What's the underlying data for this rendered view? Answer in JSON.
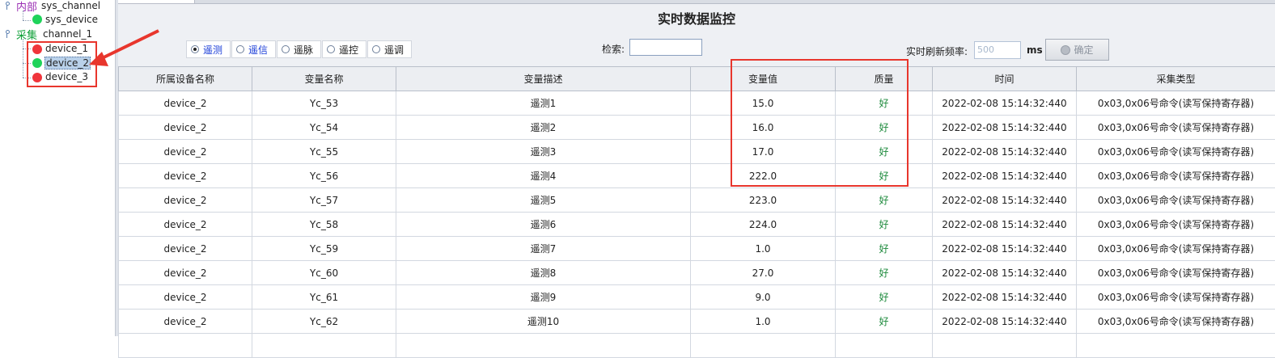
{
  "tree": {
    "internal": {
      "prefix": "内部",
      "name": "sys_channel",
      "device": "sys_device"
    },
    "collect": {
      "prefix": "采集",
      "name": "channel_1",
      "devices": [
        {
          "name": "device_1",
          "status": "red"
        },
        {
          "name": "device_2",
          "status": "green",
          "selected": true
        },
        {
          "name": "device_3",
          "status": "red"
        }
      ]
    }
  },
  "title": "实时数据监控",
  "radios": [
    {
      "label": "遥测",
      "checked": true,
      "blue": true
    },
    {
      "label": "遥信",
      "checked": false,
      "blue": true
    },
    {
      "label": "遥脉",
      "checked": false,
      "blue": false
    },
    {
      "label": "遥控",
      "checked": false,
      "blue": false
    },
    {
      "label": "遥调",
      "checked": false,
      "blue": false
    }
  ],
  "search": {
    "label": "检索:",
    "value": ""
  },
  "refresh": {
    "label": "实时刷新频率:",
    "placeholder": "500",
    "unit": "ms",
    "button": "确定"
  },
  "table": {
    "headers": [
      "所属设备名称",
      "变量名称",
      "变量描述",
      "变量值",
      "质量",
      "时间",
      "采集类型"
    ],
    "rows": [
      [
        "device_2",
        "Yc_53",
        "遥测1",
        "15.0",
        "好",
        "2022-02-08 15:14:32:440",
        "0x03,0x06号命令(读写保持寄存器)"
      ],
      [
        "device_2",
        "Yc_54",
        "遥测2",
        "16.0",
        "好",
        "2022-02-08 15:14:32:440",
        "0x03,0x06号命令(读写保持寄存器)"
      ],
      [
        "device_2",
        "Yc_55",
        "遥测3",
        "17.0",
        "好",
        "2022-02-08 15:14:32:440",
        "0x03,0x06号命令(读写保持寄存器)"
      ],
      [
        "device_2",
        "Yc_56",
        "遥测4",
        "222.0",
        "好",
        "2022-02-08 15:14:32:440",
        "0x03,0x06号命令(读写保持寄存器)"
      ],
      [
        "device_2",
        "Yc_57",
        "遥测5",
        "223.0",
        "好",
        "2022-02-08 15:14:32:440",
        "0x03,0x06号命令(读写保持寄存器)"
      ],
      [
        "device_2",
        "Yc_58",
        "遥测6",
        "224.0",
        "好",
        "2022-02-08 15:14:32:440",
        "0x03,0x06号命令(读写保持寄存器)"
      ],
      [
        "device_2",
        "Yc_59",
        "遥测7",
        "1.0",
        "好",
        "2022-02-08 15:14:32:440",
        "0x03,0x06号命令(读写保持寄存器)"
      ],
      [
        "device_2",
        "Yc_60",
        "遥测8",
        "27.0",
        "好",
        "2022-02-08 15:14:32:440",
        "0x03,0x06号命令(读写保持寄存器)"
      ],
      [
        "device_2",
        "Yc_61",
        "遥测9",
        "9.0",
        "好",
        "2022-02-08 15:14:32:440",
        "0x03,0x06号命令(读写保持寄存器)"
      ],
      [
        "device_2",
        "Yc_62",
        "遥测10",
        "1.0",
        "好",
        "2022-02-08 15:14:32:440",
        "0x03,0x06号命令(读写保持寄存器)"
      ],
      [
        "",
        "",
        "",
        "",
        "",
        "",
        ""
      ]
    ]
  },
  "colors": {
    "internal_prefix": "#9b2fb4",
    "collect_prefix": "#12a13a",
    "highlight": "#e8362d",
    "good": "#1d8a3c"
  }
}
